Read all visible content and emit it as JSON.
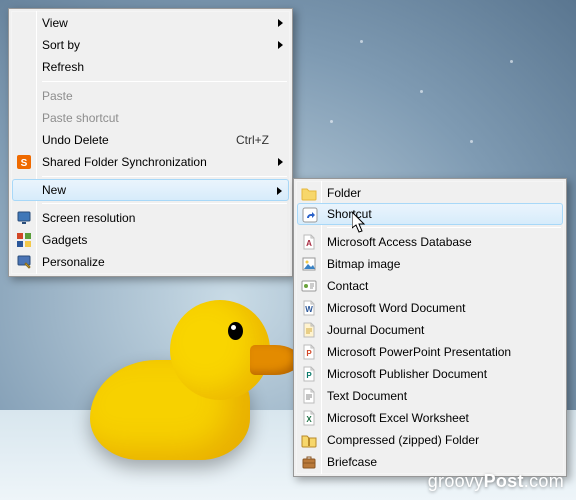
{
  "desktop": {
    "watermark_prefix": "groovy",
    "watermark_bold": "Post",
    "watermark_suffix": ".com"
  },
  "primary_menu": {
    "items": [
      {
        "label": "View",
        "icon": null,
        "submenu": true,
        "disabled": false
      },
      {
        "label": "Sort by",
        "icon": null,
        "submenu": true,
        "disabled": false
      },
      {
        "label": "Refresh",
        "icon": null,
        "submenu": false,
        "disabled": false
      },
      {
        "sep": true
      },
      {
        "label": "Paste",
        "icon": null,
        "submenu": false,
        "disabled": true
      },
      {
        "label": "Paste shortcut",
        "icon": null,
        "submenu": false,
        "disabled": true
      },
      {
        "label": "Undo Delete",
        "icon": null,
        "submenu": false,
        "disabled": false,
        "accel": "Ctrl+Z"
      },
      {
        "label": "Shared Folder Synchronization",
        "icon": "sync-s-icon",
        "submenu": true,
        "disabled": false
      },
      {
        "sep": true
      },
      {
        "label": "New",
        "icon": null,
        "submenu": true,
        "disabled": false,
        "hover": true
      },
      {
        "sep": true
      },
      {
        "label": "Screen resolution",
        "icon": "monitor-icon",
        "submenu": false,
        "disabled": false
      },
      {
        "label": "Gadgets",
        "icon": "gadgets-icon",
        "submenu": false,
        "disabled": false
      },
      {
        "label": "Personalize",
        "icon": "personalize-icon",
        "submenu": false,
        "disabled": false
      }
    ]
  },
  "new_submenu": {
    "items": [
      {
        "label": "Folder",
        "icon": "folder-icon",
        "hover": false
      },
      {
        "label": "Shortcut",
        "icon": "shortcut-icon",
        "hover": true
      },
      {
        "sep": true
      },
      {
        "label": "Microsoft Access Database",
        "icon": "access-icon"
      },
      {
        "label": "Bitmap image",
        "icon": "bitmap-icon"
      },
      {
        "label": "Contact",
        "icon": "contact-icon"
      },
      {
        "label": "Microsoft Word Document",
        "icon": "word-icon"
      },
      {
        "label": "Journal Document",
        "icon": "journal-icon"
      },
      {
        "label": "Microsoft PowerPoint Presentation",
        "icon": "ppt-icon"
      },
      {
        "label": "Microsoft Publisher Document",
        "icon": "publisher-icon"
      },
      {
        "label": "Text Document",
        "icon": "text-icon"
      },
      {
        "label": "Microsoft Excel Worksheet",
        "icon": "excel-icon"
      },
      {
        "label": "Compressed (zipped) Folder",
        "icon": "zip-icon"
      },
      {
        "label": "Briefcase",
        "icon": "briefcase-icon"
      }
    ]
  },
  "icons": {
    "folder-icon": {
      "bg": "#f7d76b",
      "accent": "#e6b73d",
      "shape": "folder"
    },
    "shortcut-icon": {
      "bg": "#ffffff",
      "accent": "#2a62c9",
      "shape": "shortcut"
    },
    "access-icon": {
      "bg": "#ffffff",
      "accent": "#a6273e",
      "shape": "doc",
      "letter": "A"
    },
    "bitmap-icon": {
      "bg": "#ffffff",
      "accent": "#3a83c5",
      "shape": "picture"
    },
    "contact-icon": {
      "bg": "#ffffff",
      "accent": "#6ba33c",
      "shape": "card"
    },
    "word-icon": {
      "bg": "#ffffff",
      "accent": "#2a5699",
      "shape": "doc",
      "letter": "W"
    },
    "journal-icon": {
      "bg": "#fff3cf",
      "accent": "#d0a93b",
      "shape": "doc"
    },
    "ppt-icon": {
      "bg": "#ffffff",
      "accent": "#d24726",
      "shape": "doc",
      "letter": "P"
    },
    "publisher-icon": {
      "bg": "#ffffff",
      "accent": "#0a7a6a",
      "shape": "doc",
      "letter": "P"
    },
    "text-icon": {
      "bg": "#ffffff",
      "accent": "#888888",
      "shape": "doc"
    },
    "excel-icon": {
      "bg": "#ffffff",
      "accent": "#1f7246",
      "shape": "doc",
      "letter": "X"
    },
    "zip-icon": {
      "bg": "#f7d76b",
      "accent": "#b88a2a",
      "shape": "zip"
    },
    "briefcase-icon": {
      "bg": "#b9793a",
      "accent": "#8a5623",
      "shape": "briefcase"
    },
    "sync-s-icon": {
      "bg": "#ef6a00",
      "accent": "#ffffff",
      "shape": "s"
    },
    "monitor-icon": {
      "bg": "#3f77b8",
      "accent": "#ffffff",
      "shape": "monitor"
    },
    "gadgets-icon": {
      "bg": "#ffffff",
      "accent": "#5a9e3a",
      "shape": "gadgets"
    },
    "personalize-icon": {
      "bg": "#4a74b5",
      "accent": "#e8c24a",
      "shape": "personalize"
    }
  }
}
